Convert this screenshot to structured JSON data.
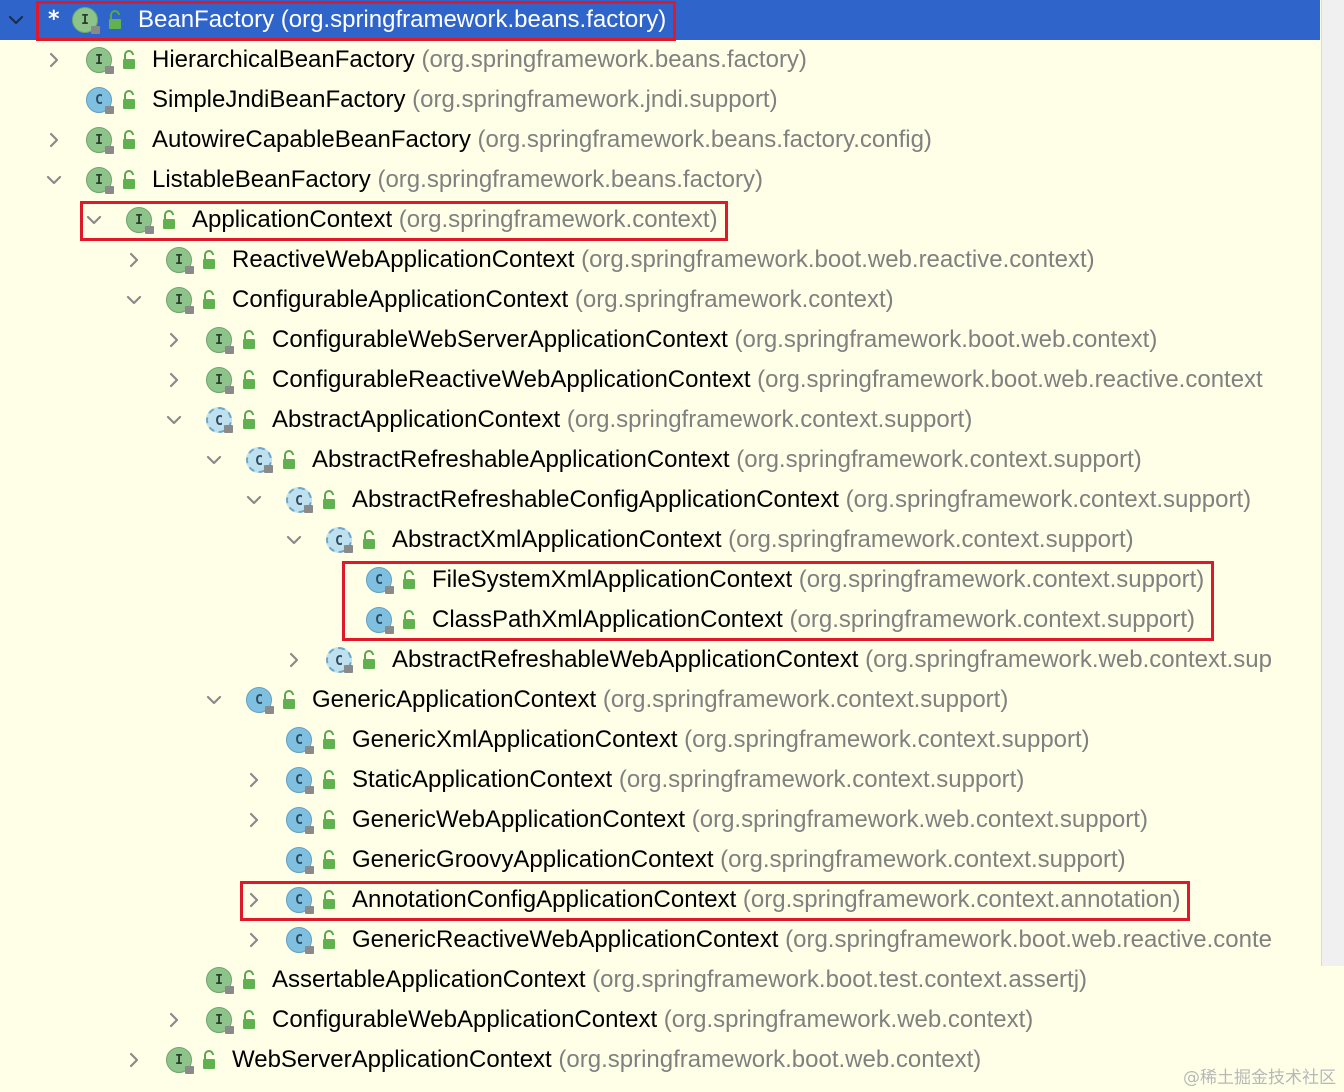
{
  "watermark": "@稀土掘金技术社区",
  "colors": {
    "background": "#ffffe8",
    "selection": "#2f65ca",
    "highlight_box": "#e0192a",
    "interface_badge": "#8dc48a",
    "class_badge": "#7fbfe0",
    "package_text": "#808080"
  },
  "icons": {
    "interface": "interface-icon",
    "class": "class-icon",
    "abstract": "abstract-class-icon",
    "public": "public-lock-icon",
    "expand": "chevron-right-icon",
    "collapse": "chevron-down-icon",
    "root": "asterisk-icon"
  },
  "badge_letters": {
    "interface": "I",
    "class": "C",
    "abstract": "C"
  },
  "tree": [
    {
      "name": "BeanFactory",
      "pkg": "(org.springframework.beans.factory)",
      "depth": 0,
      "kind": "interface",
      "arrow": "down",
      "selected": true,
      "root": true,
      "highlight": true
    },
    {
      "name": "HierarchicalBeanFactory",
      "pkg": "(org.springframework.beans.factory)",
      "depth": 1,
      "kind": "interface",
      "arrow": "right"
    },
    {
      "name": "SimpleJndiBeanFactory",
      "pkg": "(org.springframework.jndi.support)",
      "depth": 1,
      "kind": "class",
      "arrow": "none"
    },
    {
      "name": "AutowireCapableBeanFactory",
      "pkg": "(org.springframework.beans.factory.config)",
      "depth": 1,
      "kind": "interface",
      "arrow": "right"
    },
    {
      "name": "ListableBeanFactory",
      "pkg": "(org.springframework.beans.factory)",
      "depth": 1,
      "kind": "interface",
      "arrow": "down"
    },
    {
      "name": "ApplicationContext",
      "pkg": "(org.springframework.context)",
      "depth": 2,
      "kind": "interface",
      "arrow": "down",
      "highlight": true
    },
    {
      "name": "ReactiveWebApplicationContext",
      "pkg": "(org.springframework.boot.web.reactive.context)",
      "depth": 3,
      "kind": "interface",
      "arrow": "right"
    },
    {
      "name": "ConfigurableApplicationContext",
      "pkg": "(org.springframework.context)",
      "depth": 3,
      "kind": "interface",
      "arrow": "down"
    },
    {
      "name": "ConfigurableWebServerApplicationContext",
      "pkg": "(org.springframework.boot.web.context)",
      "depth": 4,
      "kind": "interface",
      "arrow": "right"
    },
    {
      "name": "ConfigurableReactiveWebApplicationContext",
      "pkg": "(org.springframework.boot.web.reactive.context",
      "depth": 4,
      "kind": "interface",
      "arrow": "right"
    },
    {
      "name": "AbstractApplicationContext",
      "pkg": "(org.springframework.context.support)",
      "depth": 4,
      "kind": "abstract",
      "arrow": "down"
    },
    {
      "name": "AbstractRefreshableApplicationContext",
      "pkg": "(org.springframework.context.support)",
      "depth": 5,
      "kind": "abstract",
      "arrow": "down"
    },
    {
      "name": "AbstractRefreshableConfigApplicationContext",
      "pkg": "(org.springframework.context.support)",
      "depth": 6,
      "kind": "abstract",
      "arrow": "down"
    },
    {
      "name": "AbstractXmlApplicationContext",
      "pkg": "(org.springframework.context.support)",
      "depth": 7,
      "kind": "abstract",
      "arrow": "down"
    },
    {
      "name": "FileSystemXmlApplicationContext",
      "pkg": "(org.springframework.context.support)",
      "depth": 8,
      "kind": "class",
      "arrow": "none",
      "highlight": true
    },
    {
      "name": "ClassPathXmlApplicationContext",
      "pkg": "(org.springframework.context.support)",
      "depth": 8,
      "kind": "class",
      "arrow": "none",
      "highlight": true
    },
    {
      "name": "AbstractRefreshableWebApplicationContext",
      "pkg": "(org.springframework.web.context.sup",
      "depth": 7,
      "kind": "abstract",
      "arrow": "right"
    },
    {
      "name": "GenericApplicationContext",
      "pkg": "(org.springframework.context.support)",
      "depth": 5,
      "kind": "class",
      "arrow": "down"
    },
    {
      "name": "GenericXmlApplicationContext",
      "pkg": "(org.springframework.context.support)",
      "depth": 6,
      "kind": "class",
      "arrow": "none"
    },
    {
      "name": "StaticApplicationContext",
      "pkg": "(org.springframework.context.support)",
      "depth": 6,
      "kind": "class",
      "arrow": "right"
    },
    {
      "name": "GenericWebApplicationContext",
      "pkg": "(org.springframework.web.context.support)",
      "depth": 6,
      "kind": "class",
      "arrow": "right"
    },
    {
      "name": "GenericGroovyApplicationContext",
      "pkg": "(org.springframework.context.support)",
      "depth": 6,
      "kind": "class",
      "arrow": "none"
    },
    {
      "name": "AnnotationConfigApplicationContext",
      "pkg": "(org.springframework.context.annotation)",
      "depth": 6,
      "kind": "class",
      "arrow": "right",
      "highlight": true
    },
    {
      "name": "GenericReactiveWebApplicationContext",
      "pkg": "(org.springframework.boot.web.reactive.conte",
      "depth": 6,
      "kind": "class",
      "arrow": "right"
    },
    {
      "name": "AssertableApplicationContext",
      "pkg": "(org.springframework.boot.test.context.assertj)",
      "depth": 4,
      "kind": "interface",
      "arrow": "none"
    },
    {
      "name": "ConfigurableWebApplicationContext",
      "pkg": "(org.springframework.web.context)",
      "depth": 4,
      "kind": "interface",
      "arrow": "right"
    },
    {
      "name": "WebServerApplicationContext",
      "pkg": "(org.springframework.boot.web.context)",
      "depth": 3,
      "kind": "interface",
      "arrow": "right"
    }
  ]
}
